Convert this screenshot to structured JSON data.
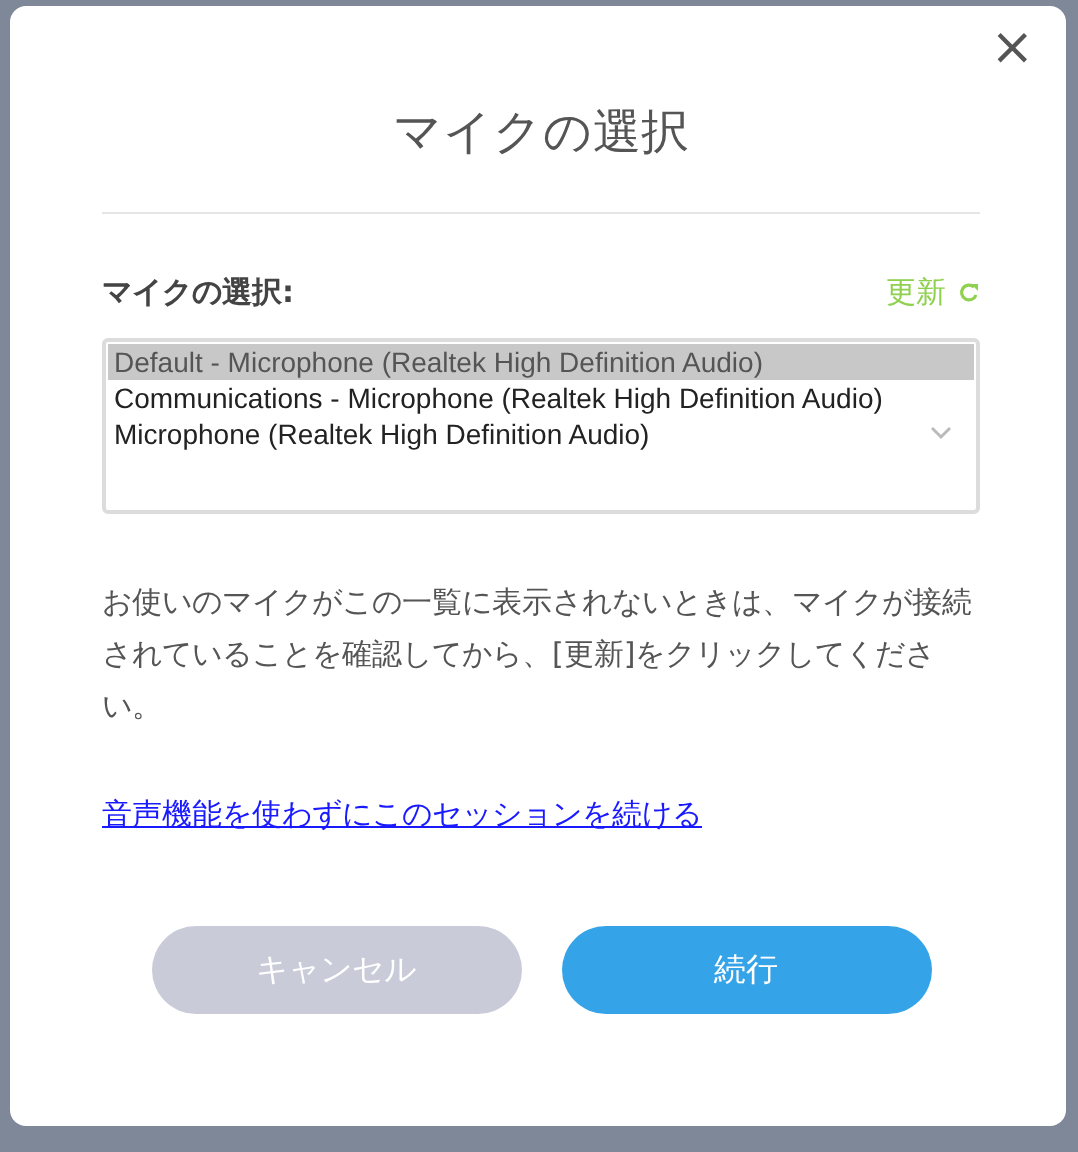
{
  "dialog": {
    "title": "マイクの選択",
    "close_icon": "×"
  },
  "microphone": {
    "label": "マイクの選択:",
    "refresh": "更新",
    "options": [
      {
        "label": "Default - Microphone (Realtek High Definition Audio)",
        "selected": true
      },
      {
        "label": "Communications - Microphone (Realtek High Definition Audio)",
        "selected": false
      },
      {
        "label": "Microphone (Realtek High Definition Audio)",
        "selected": false
      }
    ]
  },
  "help_text": "お使いのマイクがこの一覧に表示されないときは、マイクが接続されていることを確認してから、[更新]をクリックしてください。",
  "skip_audio_link": "音声機能を使わずにこのセッションを続ける",
  "buttons": [
    {
      "label": "キャンセル",
      "kind": "secondary"
    },
    {
      "label": "続行",
      "kind": "primary"
    }
  ]
}
